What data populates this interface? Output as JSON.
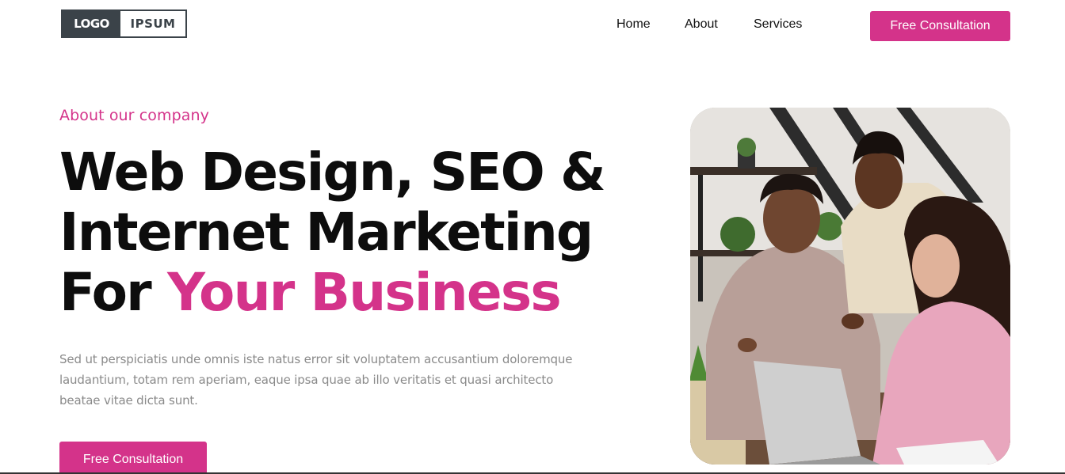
{
  "header": {
    "logo_left": "LOGO",
    "logo_right": "IPSUM",
    "nav": [
      "Home",
      "About",
      "Services"
    ],
    "cta_label": "Free Consultation"
  },
  "hero": {
    "eyebrow": "About our company",
    "headline_line1": "Web Design, SEO &",
    "headline_line2": "Internet Marketing",
    "headline_line3_plain": "For ",
    "headline_line3_accent": "Your Business",
    "paragraph": "Sed ut perspiciatis unde omnis iste natus error sit voluptatem accusantium doloremque laudantium, totam rem aperiam, eaque ipsa quae ab illo veritatis et quasi architecto beatae vitae dicta sunt.",
    "cta_label": "Free Consultation"
  },
  "colors": {
    "accent": "#d4338a",
    "text_dark": "#0d0d0d",
    "text_muted": "#8a8a8a",
    "logo_dark": "#3b4349"
  }
}
